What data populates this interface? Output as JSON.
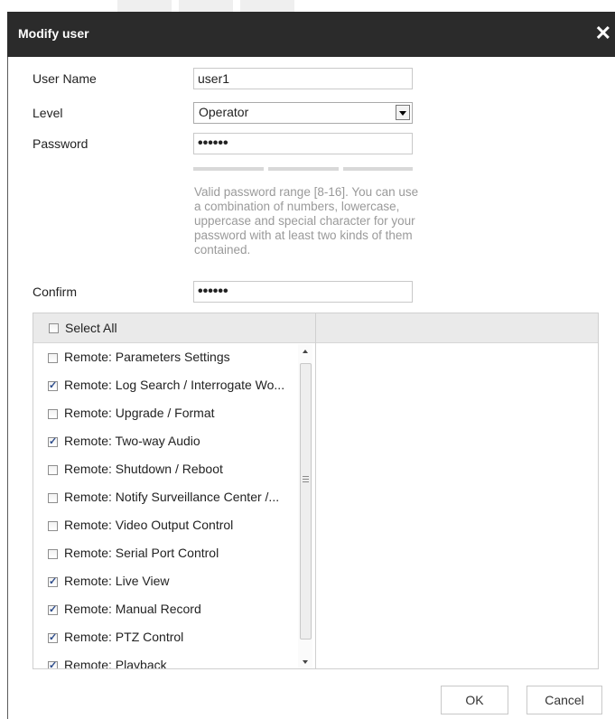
{
  "dialog": {
    "title": "Modify user"
  },
  "form": {
    "user_name_label": "User Name",
    "user_name_value": "user1",
    "level_label": "Level",
    "level_value": "Operator",
    "password_label": "Password",
    "password_value": "••••••",
    "password_hint": "Valid password range [8-16]. You can use a combination of numbers, lowercase, uppercase and special character for your password with at least two kinds of them contained.",
    "confirm_label": "Confirm",
    "confirm_value": "••••••"
  },
  "permissions": {
    "select_all_label": "Select All",
    "items": [
      {
        "label": "Remote: Parameters Settings",
        "checked": false
      },
      {
        "label": "Remote: Log Search / Interrogate Wo...",
        "checked": true
      },
      {
        "label": "Remote: Upgrade / Format",
        "checked": false
      },
      {
        "label": "Remote: Two-way Audio",
        "checked": true
      },
      {
        "label": "Remote: Shutdown / Reboot",
        "checked": false
      },
      {
        "label": "Remote: Notify Surveillance Center /...",
        "checked": false
      },
      {
        "label": "Remote: Video Output Control",
        "checked": false
      },
      {
        "label": "Remote: Serial Port Control",
        "checked": false
      },
      {
        "label": "Remote: Live View",
        "checked": true
      },
      {
        "label": "Remote: Manual Record",
        "checked": true
      },
      {
        "label": "Remote: PTZ Control",
        "checked": true
      },
      {
        "label": "Remote: Playback",
        "checked": true
      }
    ]
  },
  "buttons": {
    "ok": "OK",
    "cancel": "Cancel"
  }
}
